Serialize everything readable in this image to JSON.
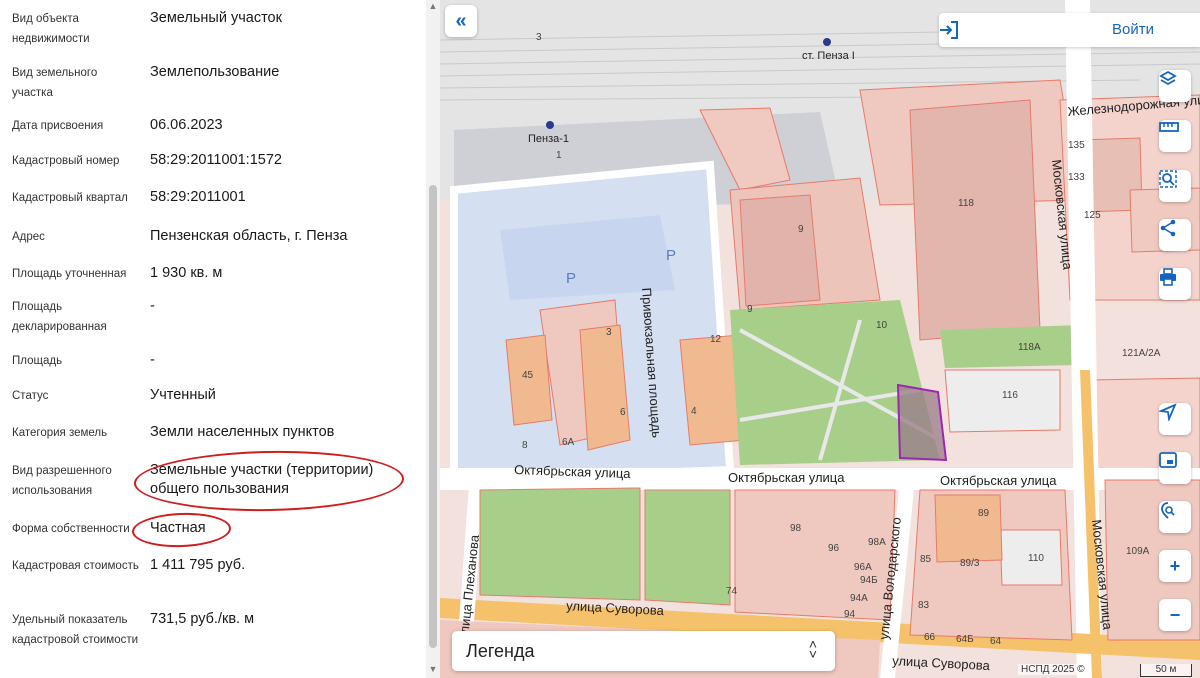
{
  "properties": [
    {
      "label": "Вид объекта недвижимости",
      "value": "Земельный участок"
    },
    {
      "label": "Вид земельного участка",
      "value": "Землепользование"
    },
    {
      "label": "Дата присвоения",
      "value": "06.06.2023"
    },
    {
      "label": "Кадастровый номер",
      "value": "58:29:2011001:1572"
    },
    {
      "label": "Кадастровый квартал",
      "value": "58:29:2011001"
    },
    {
      "label": "Адрес",
      "value": "Пензенская область, г. Пенза"
    },
    {
      "label": "Площадь уточненная",
      "value": "1 930 кв. м"
    },
    {
      "label": "Площадь декларированная",
      "value": "-"
    },
    {
      "label": "Площадь",
      "value": "-"
    },
    {
      "label": "Статус",
      "value": "Учтенный"
    },
    {
      "label": "Категория земель",
      "value": "Земли населенных пунктов"
    },
    {
      "label": "Вид разрешенного использования",
      "value": "Земельные участки (территории) общего пользования"
    },
    {
      "label": "Форма собственности",
      "value": "Частная"
    },
    {
      "label": "Кадастровая стоимость",
      "value": "1 411 795 руб."
    },
    {
      "label": "Удельный показатель кадастровой стоимости",
      "value": "731,5 руб./кв. м"
    }
  ],
  "map": {
    "login_label": "Войти",
    "legend_label": "Легенда",
    "copyright": "НСПД 2025 ©",
    "scale_label": "50 м",
    "streets": {
      "oktyabrskaya_1": "Октябрьская улица",
      "oktyabrskaya_2": "Октябрьская улица",
      "oktyabrskaya_3": "Октябрьская улица",
      "suvorova_1": "улица Суворова",
      "suvorova_2": "улица Суворова",
      "moskovskaya_1": "Московская улица",
      "moskovskaya_2": "Московская улица",
      "plekhanova": "улица Плеханова",
      "volodarskogo": "улица Володарского",
      "privokzalnaya": "Привокзальная площадь",
      "zheleznodorozhnaya": "Железнодорожная улица"
    },
    "stations": {
      "penza_1": "Пенза-1",
      "penza_i": "ст. Пенза I"
    },
    "parking": [
      "P",
      "P"
    ],
    "numbers": [
      "3",
      "1",
      "9",
      "9",
      "10",
      "118",
      "118А",
      "116",
      "135",
      "133",
      "125",
      "121А/2А",
      "45",
      "3",
      "6",
      "6А",
      "8",
      "4",
      "12",
      "98",
      "98А",
      "96",
      "96А",
      "94Б",
      "94А",
      "94",
      "89",
      "85",
      "89/3",
      "83",
      "110",
      "109А",
      "74",
      "66",
      "64Б",
      "64"
    ],
    "colors": {
      "parcel": "#e87a6a",
      "selected": "#9c27b0",
      "accent": "#1565c0",
      "annotation": "#d01c1c"
    }
  }
}
